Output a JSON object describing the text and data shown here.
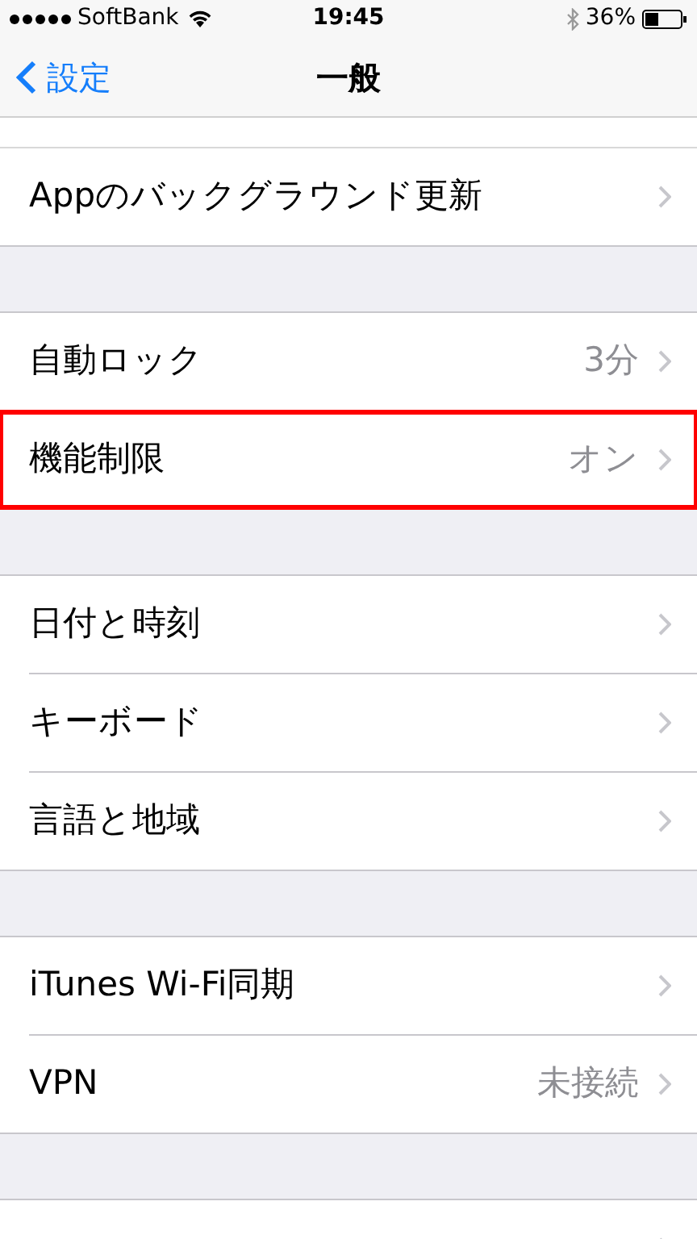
{
  "status_bar": {
    "carrier": "SoftBank",
    "time": "19:45",
    "battery": "36%"
  },
  "nav": {
    "back": "設定",
    "title": "一般"
  },
  "groups": [
    {
      "rows": [
        {
          "label": "Appのバックグラウンド更新",
          "highlighted": false
        }
      ]
    },
    {
      "rows": [
        {
          "label": "自動ロック",
          "value": "3分",
          "highlighted": false
        },
        {
          "label": "機能制限",
          "value": "オン",
          "highlighted": true
        }
      ]
    },
    {
      "rows": [
        {
          "label": "日付と時刻",
          "highlighted": false
        },
        {
          "label": "キーボード",
          "highlighted": false
        },
        {
          "label": "言語と地域",
          "highlighted": false
        }
      ]
    },
    {
      "rows": [
        {
          "label": "iTunes Wi-Fi同期",
          "highlighted": false
        },
        {
          "label": "VPN",
          "value": "未接続",
          "highlighted": false
        }
      ]
    },
    {
      "rows": [
        {
          "highlighted": false
        }
      ]
    }
  ]
}
